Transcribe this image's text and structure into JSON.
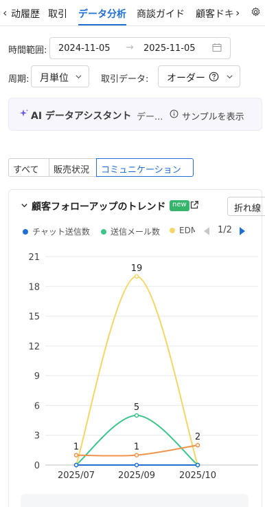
{
  "tabs": [
    {
      "label": "动履歴",
      "active": false
    },
    {
      "label": "取引",
      "active": false
    },
    {
      "label": "データ分析",
      "active": true
    },
    {
      "label": "商談ガイド",
      "active": false
    },
    {
      "label": "顧客ドキ",
      "active": false
    }
  ],
  "filters": {
    "time_range_label": "時間範囲:",
    "start_date": "2024-11-05",
    "end_date": "2025-11-05",
    "period_label": "周期:",
    "period_value": "月単位",
    "trade_data_label": "取引データ:",
    "trade_data_value": "オーダー"
  },
  "ai_bar": {
    "title": "AI データアシスタント",
    "desc": "デー...",
    "sample_label": "サンプルを表示"
  },
  "segments": [
    {
      "label": "すべて",
      "active": false
    },
    {
      "label": "販売状況",
      "active": false
    },
    {
      "label": "コミュニケーション",
      "active": true
    }
  ],
  "card": {
    "title": "顧客フォローアップのトレンド",
    "badge": "new",
    "chart_type_button": "折れ線"
  },
  "legend": {
    "items": [
      {
        "name": "チャット送信数",
        "color": "#1f6fd6"
      },
      {
        "name": "送信メール数",
        "color": "#3cc48a"
      },
      {
        "name": "EDM",
        "color": "#f2d666"
      }
    ],
    "page": "1/2"
  },
  "chart_data": {
    "type": "line",
    "categories": [
      "2025/07",
      "2025/09",
      "2025/10"
    ],
    "ylim": [
      0,
      21
    ],
    "yticks": [
      0,
      3,
      6,
      9,
      12,
      15,
      18,
      21
    ],
    "grid": true,
    "series": [
      {
        "name": "チャット送信数",
        "color": "#1f6fd6",
        "values": [
          0,
          0,
          0
        ]
      },
      {
        "name": "送信メール数",
        "color": "#3cc48a",
        "values": [
          0,
          5,
          0
        ]
      },
      {
        "name": "EDM",
        "color": "#f2d666",
        "values": [
          0,
          19,
          0
        ]
      },
      {
        "name": "",
        "color": "#f0934a",
        "values": [
          1,
          1,
          2
        ]
      }
    ],
    "point_labels": [
      {
        "series": 2,
        "index": 1,
        "text": "19"
      },
      {
        "series": 1,
        "index": 1,
        "text": "5"
      },
      {
        "series": 3,
        "index": 0,
        "text": "1"
      },
      {
        "series": 3,
        "index": 1,
        "text": "1"
      },
      {
        "series": 3,
        "index": 2,
        "text": "2"
      }
    ]
  }
}
